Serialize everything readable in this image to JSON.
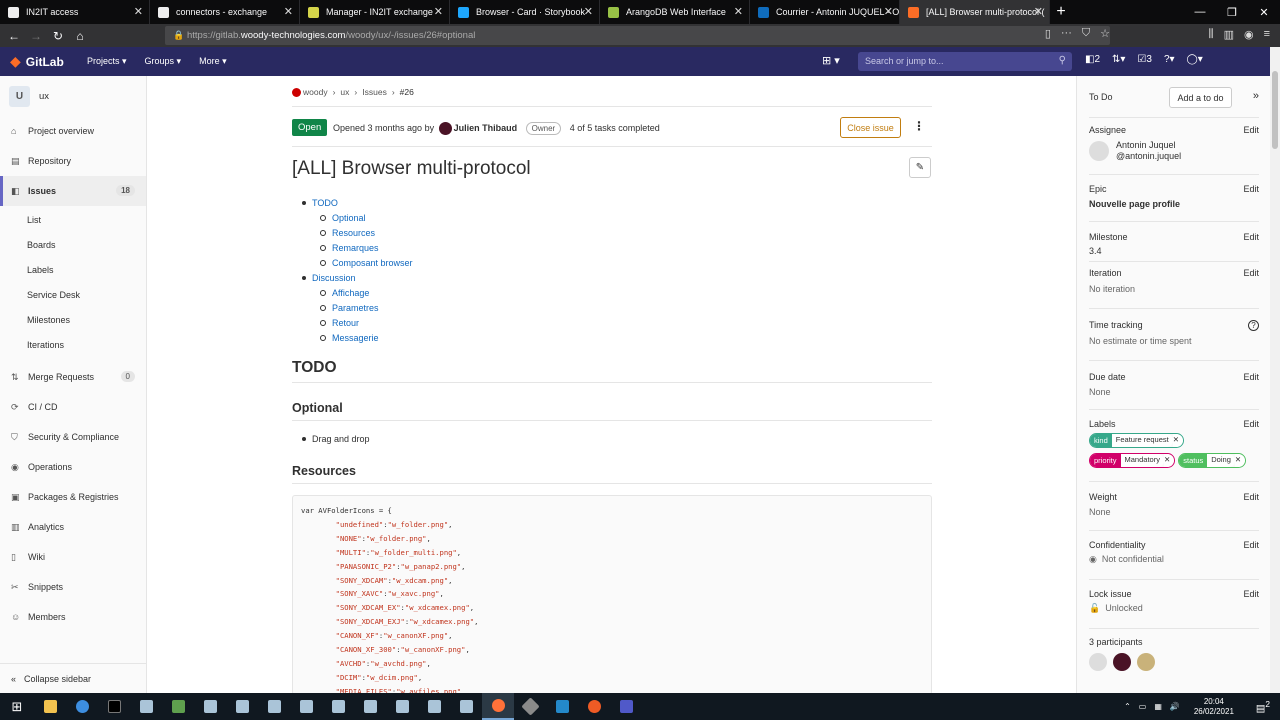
{
  "browser": {
    "tabs": [
      {
        "label": "IN2IT access",
        "color": "#e8e8e8"
      },
      {
        "label": "connectors - exchange",
        "color": "#e8e8e8"
      },
      {
        "label": "Manager - IN2IT exchange",
        "color": "#d4d44a"
      },
      {
        "label": "Browser - Card · Storybook",
        "color": "#1ea7fd"
      },
      {
        "label": "ArangoDB Web Interface",
        "color": "#98c146"
      },
      {
        "label": "Courrier - Antonin JUQUEL - O",
        "color": "#0f6cbd"
      },
      {
        "label": "[ALL] Browser multi-protocol (",
        "color": "#fc6d26"
      }
    ],
    "url_prefix": "https://gitlab.",
    "url_host": "woody-technologies.com",
    "url_path": "/woody/ux/-/issues/26#optional"
  },
  "gitlab_nav": {
    "brand": "GitLab",
    "menus": [
      "Projects ▾",
      "Groups ▾",
      "More ▾"
    ],
    "search_placeholder": "Search or jump to...",
    "counts": {
      "issues": "2",
      "mrs": "",
      "todos": "3"
    }
  },
  "sidebar": {
    "project_initial": "U",
    "project_name": "ux",
    "items": [
      {
        "label": "Project overview",
        "icon": "⌂"
      },
      {
        "label": "Repository",
        "icon": "▤"
      },
      {
        "label": "Issues",
        "icon": "◧",
        "count": "18"
      },
      {
        "label": "Merge Requests",
        "icon": "⇅",
        "count": "0"
      },
      {
        "label": "CI / CD",
        "icon": "⟳"
      },
      {
        "label": "Security & Compliance",
        "icon": "⛉"
      },
      {
        "label": "Operations",
        "icon": "◉"
      },
      {
        "label": "Packages & Registries",
        "icon": "▣"
      },
      {
        "label": "Analytics",
        "icon": "▥"
      },
      {
        "label": "Wiki",
        "icon": "▯"
      },
      {
        "label": "Snippets",
        "icon": "✂"
      },
      {
        "label": "Members",
        "icon": "☺"
      }
    ],
    "issue_subitems": [
      "List",
      "Boards",
      "Labels",
      "Service Desk",
      "Milestones",
      "Iterations"
    ],
    "collapse": "Collapse sidebar"
  },
  "issue": {
    "breadcrumbs": [
      "woody",
      "ux",
      "Issues",
      "#26"
    ],
    "status": "Open",
    "opened_prefix": "Opened 3 months ago by",
    "author": "Julien Thibaud",
    "role": "Owner",
    "tasks": "4 of 5 tasks completed",
    "close_label": "Close issue",
    "title": "[ALL] Browser multi-protocol",
    "toc": [
      {
        "label": "TODO",
        "level": 1
      },
      {
        "label": "Optional",
        "level": 2
      },
      {
        "label": "Resources",
        "level": 2
      },
      {
        "label": "Remarques",
        "level": 2
      },
      {
        "label": "Composant browser",
        "level": 2
      },
      {
        "label": "Discussion",
        "level": 1
      },
      {
        "label": "Affichage",
        "level": 2
      },
      {
        "label": "Parametres",
        "level": 2
      },
      {
        "label": "Retour",
        "level": 2
      },
      {
        "label": "Messagerie",
        "level": 2
      }
    ],
    "h_todo": "TODO",
    "h_optional": "Optional",
    "optional_item": "Drag and drop",
    "h_resources": "Resources",
    "code_header": "var AVFolderIcons = {",
    "code_lines": [
      [
        "\"undefined\"",
        "\"w_folder.png\""
      ],
      [
        "\"NONE\"",
        "\"w_folder.png\""
      ],
      [
        "\"MULTI\"",
        "\"w_folder_multi.png\""
      ],
      [
        "\"PANASONIC_P2\"",
        "\"w_panap2.png\""
      ],
      [
        "\"SONY_XDCAM\"",
        "\"w_xdcam.png\""
      ],
      [
        "\"SONY_XAVC\"",
        "\"w_xavc.png\""
      ],
      [
        "\"SONY_XDCAM_EX\"",
        "\"w_xdcamex.png\""
      ],
      [
        "\"SONY_XDCAM_EXJ\"",
        "\"w_xdcamex.png\""
      ],
      [
        "\"CANON_XF\"",
        "\"w_canonXF.png\""
      ],
      [
        "\"CANON_XF_300\"",
        "\"w_canonXF.png\""
      ],
      [
        "\"AVCHD\"",
        "\"w_avchd.png\""
      ],
      [
        "\"DCIM\"",
        "\"w_dcim.png\""
      ],
      [
        "\"MEDIA_FILES\"",
        "\"w_avfiles.png\""
      ]
    ]
  },
  "right_sidebar": {
    "todo": "To Do",
    "add_todo": "Add a to do",
    "edit": "Edit",
    "assignee_label": "Assignee",
    "assignee_name": "Antonin Juquel",
    "assignee_handle": "@antonin.juquel",
    "epic_label": "Epic",
    "epic_value": "Nouvelle page profile",
    "milestone_label": "Milestone",
    "milestone_value": "3.4",
    "iteration_label": "Iteration",
    "iteration_value": "No iteration",
    "time_label": "Time tracking",
    "time_value": "No estimate or time spent",
    "due_label": "Due date",
    "due_value": "None",
    "labels_label": "Labels",
    "labels": [
      {
        "key": "kind",
        "value": "Feature request",
        "color": "#36a88a"
      },
      {
        "key": "priority",
        "value": "Mandatory",
        "color": "#d10069"
      },
      {
        "key": "status",
        "value": "Doing",
        "color": "#4fbf5f"
      }
    ],
    "weight_label": "Weight",
    "weight_value": "None",
    "conf_label": "Confidentiality",
    "conf_value": "Not confidential",
    "lock_label": "Lock issue",
    "lock_value": "Unlocked",
    "participants_label": "3 participants"
  },
  "taskbar": {
    "time": "20:04",
    "date": "26/02/2021",
    "notif": "2"
  }
}
